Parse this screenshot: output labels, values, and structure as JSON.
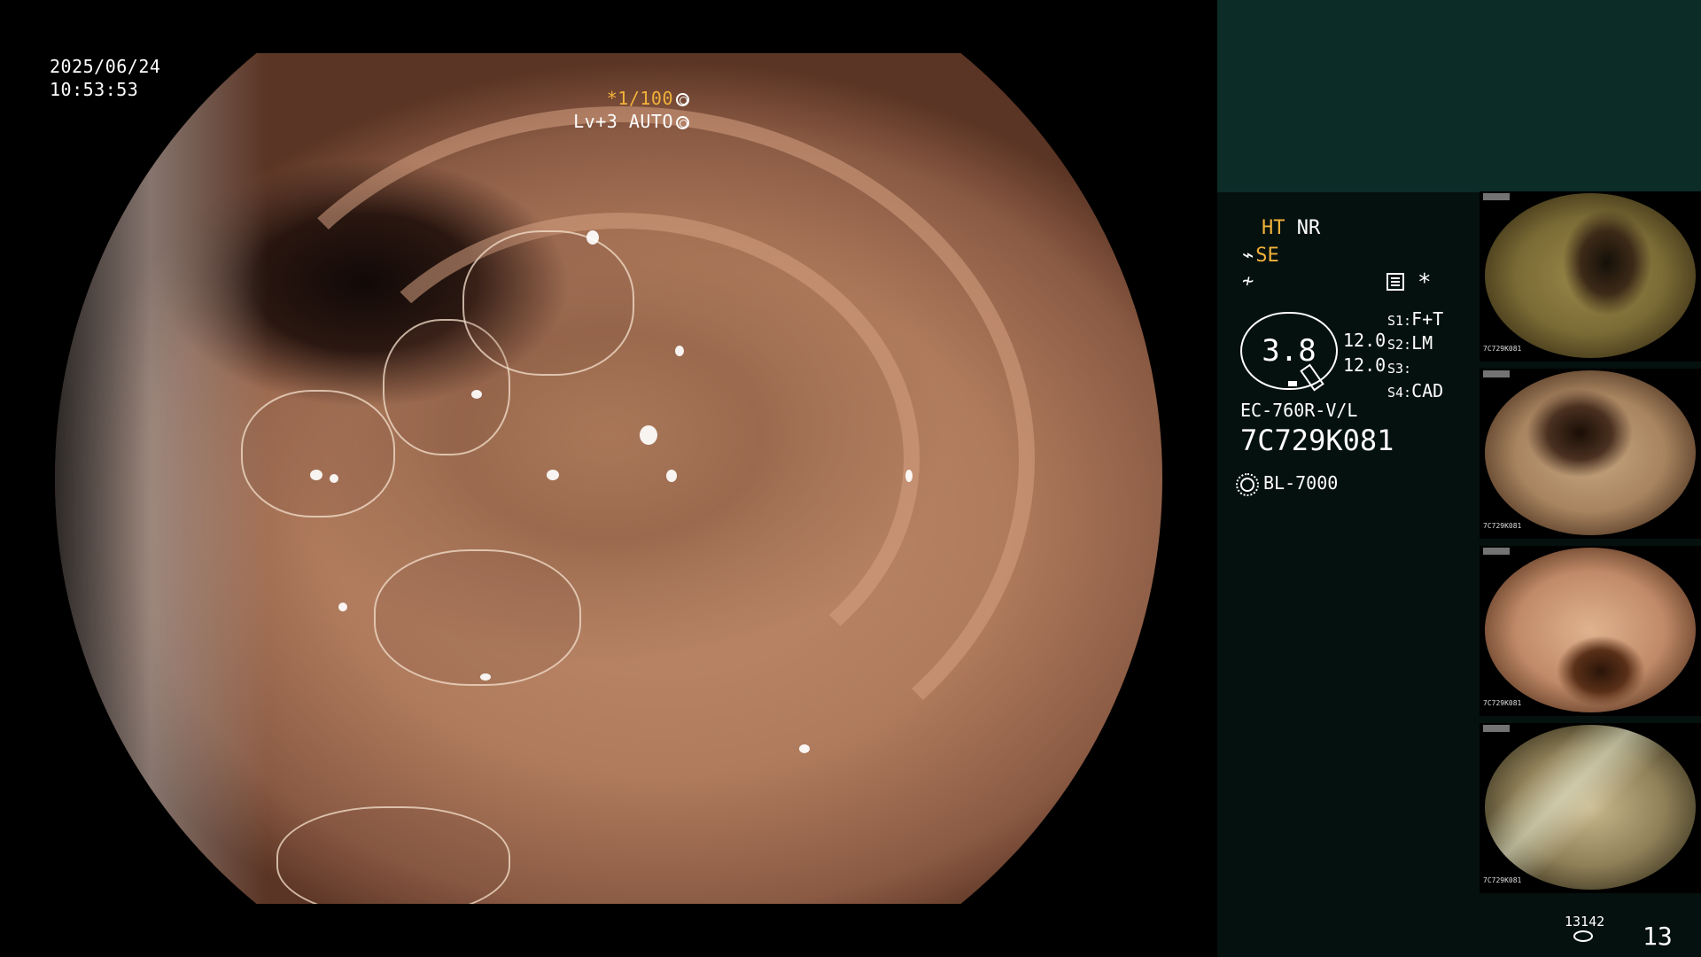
{
  "datetime": {
    "date": "2025/06/24",
    "time": "10:53:53"
  },
  "shutter": {
    "star": "*",
    "value": "1/100",
    "level": "Lv+3",
    "mode": "AUTO"
  },
  "modes": {
    "ht": "HT",
    "nr": "NR",
    "se": "SE"
  },
  "indicator": {
    "value": "3.8",
    "level_top": "12.0",
    "level_bottom": "12.0",
    "asterisk": "*"
  },
  "switches": [
    {
      "key": "S1:",
      "value": "F+T"
    },
    {
      "key": "S2:",
      "value": "LM"
    },
    {
      "key": "S3:",
      "value": ""
    },
    {
      "key": "S4:",
      "value": "CAD"
    }
  ],
  "scope": {
    "model": "EC-760R-V/L",
    "serial": "7C729K081"
  },
  "light_source": {
    "label": "BL-7000",
    "icon": "sun-icon"
  },
  "thumbnails": [
    {
      "id": "7C729K081"
    },
    {
      "id": "7C729K081"
    },
    {
      "id": "7C729K081"
    },
    {
      "id": "7C729K081"
    }
  ],
  "counters": {
    "image_count": "13142",
    "page": "13"
  },
  "colors": {
    "accent_orange": "#f2b23a",
    "panel_dark": "#05110f",
    "panel_top": "#0c2c28"
  }
}
